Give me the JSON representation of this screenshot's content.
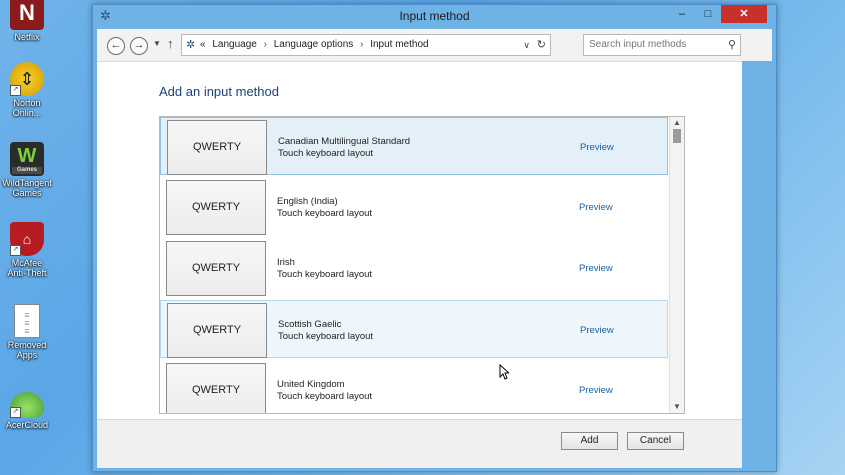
{
  "desktop": {
    "icons": [
      {
        "label": "Netflix"
      },
      {
        "label": "Norton Onlin..."
      },
      {
        "label": "WildTangent Games"
      },
      {
        "label": "McAfee Anti-Theft"
      },
      {
        "label": "Removed Apps"
      },
      {
        "label": "AcerCloud"
      }
    ],
    "games_badge": "Games"
  },
  "window": {
    "title": "Input method",
    "controls": {
      "minimize": "–",
      "maximize": "□",
      "close": "✕"
    }
  },
  "address_bar": {
    "breadcrumb_prefix": "«",
    "breadcrumbs": [
      "Language",
      "Language options",
      "Input method"
    ],
    "search_placeholder": "Search input methods"
  },
  "main": {
    "heading": "Add an input method",
    "items": [
      {
        "thumb": "QWERTY",
        "name": "Canadian Multilingual Standard",
        "type": "Touch keyboard layout",
        "action": "Preview",
        "state": "selected"
      },
      {
        "thumb": "QWERTY",
        "name": "English (India)",
        "type": "Touch keyboard layout",
        "action": "Preview",
        "state": "normal"
      },
      {
        "thumb": "QWERTY",
        "name": "Irish",
        "type": "Touch keyboard layout",
        "action": "Preview",
        "state": "normal"
      },
      {
        "thumb": "QWERTY",
        "name": "Scottish Gaelic",
        "type": "Touch keyboard layout",
        "action": "Preview",
        "state": "hover"
      },
      {
        "thumb": "QWERTY",
        "name": "United Kingdom",
        "type": "Touch keyboard layout",
        "action": "Preview",
        "state": "normal"
      }
    ]
  },
  "footer": {
    "add_label": "Add",
    "cancel_label": "Cancel"
  },
  "colors": {
    "accent": "#1e3f7a",
    "link": "#1f5ea8",
    "close": "#c7302b",
    "selected_bg": "#e3f0f8"
  }
}
